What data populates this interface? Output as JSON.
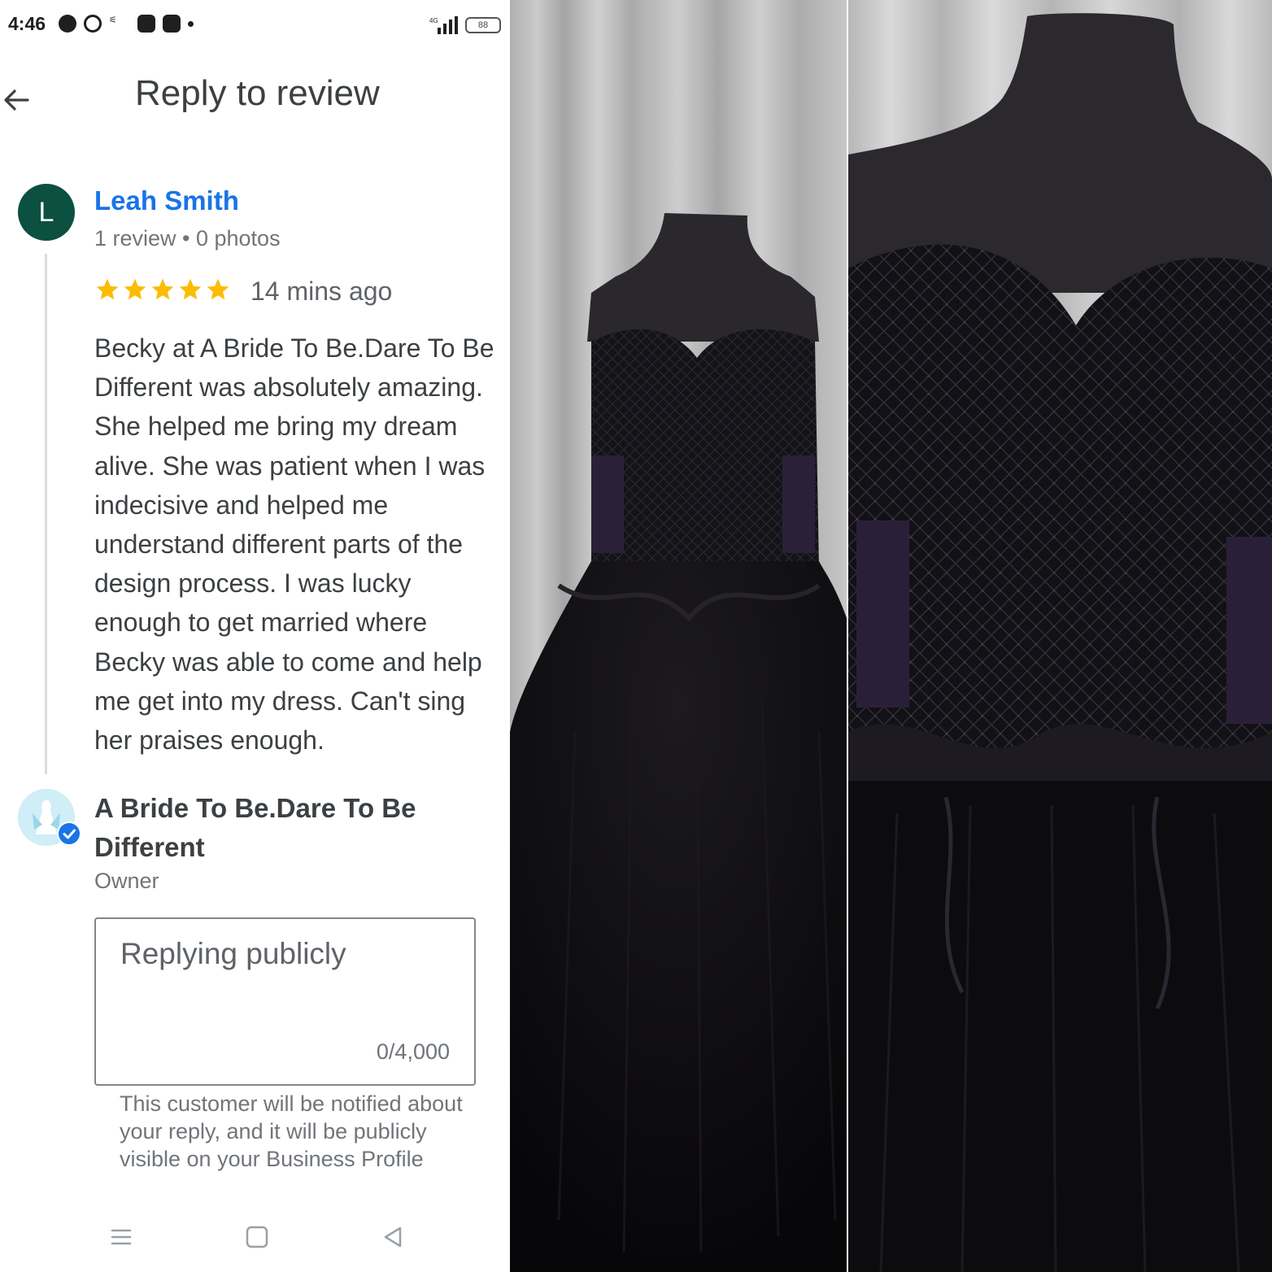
{
  "status_bar": {
    "time": "4:46",
    "battery": "88"
  },
  "app_bar": {
    "title": "Reply to review",
    "back_icon": "arrow-left-icon"
  },
  "review": {
    "avatar_initial": "L",
    "avatar_color": "#0b5040",
    "reviewer_name": "Leah Smith",
    "reviewer_meta": "1 review • 0 photos",
    "rating": 5,
    "time_ago": "14 mins ago",
    "text": "Becky at A Bride To Be.Dare To Be Different was absolutely amazing. She helped me bring my dream alive. She was patient when I was indecisive and helped me understand different parts of the design process. I was lucky enough to get married where Becky was able to come and help me get into my dress. Can't sing her praises enough."
  },
  "owner": {
    "name": "A Bride To Be.Dare To Be Different",
    "role": "Owner"
  },
  "reply": {
    "placeholder": "Replying publicly",
    "char_count": "0/4,000",
    "helper": "This customer will be notified about your reply, and it will be publicly visible on your Business Profile"
  },
  "colors": {
    "link": "#1a73e8",
    "star": "#fbbc04",
    "text": "#3c4043",
    "muted": "#70757a"
  },
  "nav_icons": [
    "menu-icon",
    "home-square-icon",
    "back-triangle-icon"
  ]
}
